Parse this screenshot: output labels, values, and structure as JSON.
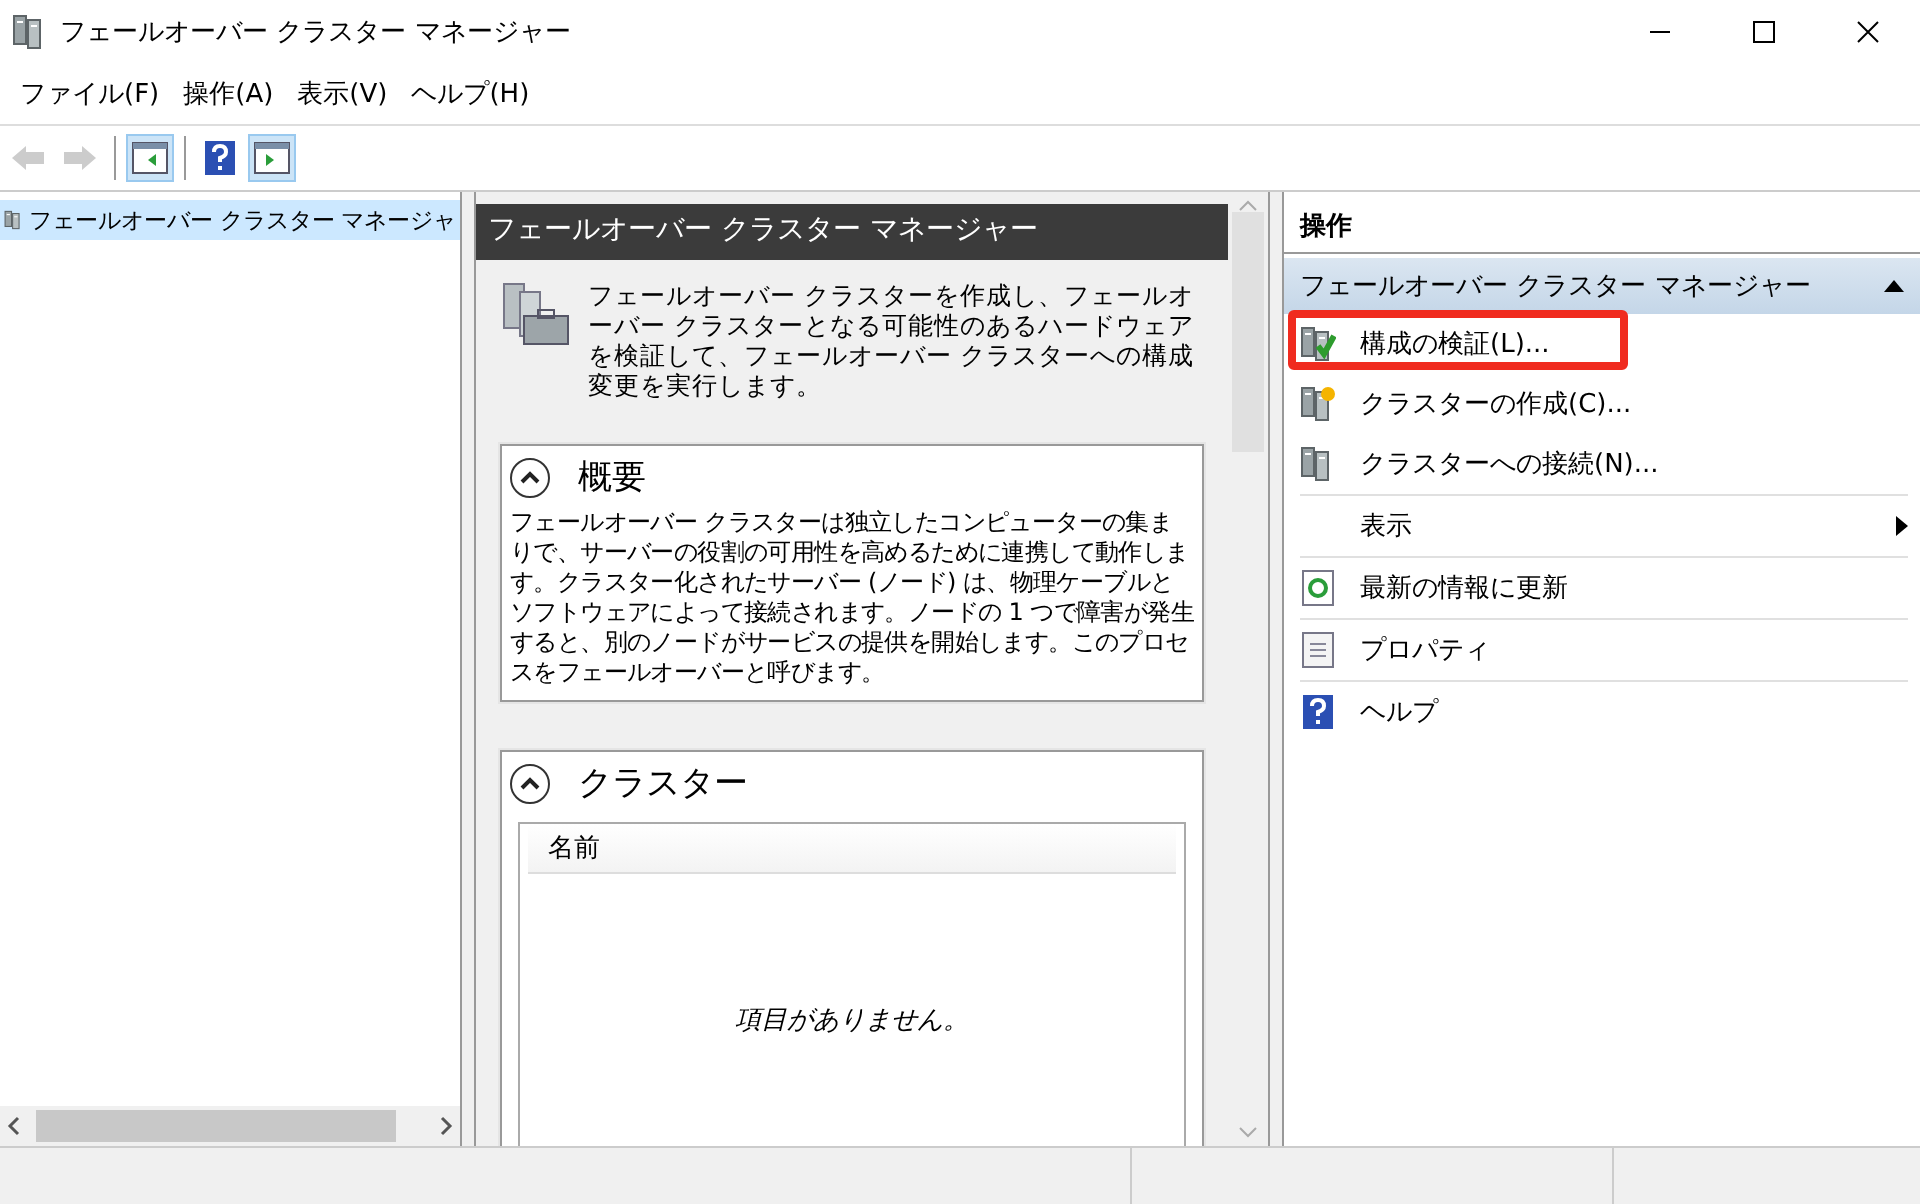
{
  "window": {
    "title": "フェールオーバー クラスター マネージャー"
  },
  "menu": [
    "ファイル(F)",
    "操作(A)",
    "表示(V)",
    "ヘルプ(H)"
  ],
  "toolbar": [
    {
      "kind": "back",
      "disabled": true,
      "pressed": false
    },
    {
      "kind": "forward",
      "disabled": true,
      "pressed": false
    },
    {
      "kind": "tree-toggle",
      "disabled": false,
      "pressed": true
    },
    {
      "kind": "help",
      "disabled": false,
      "pressed": false
    },
    {
      "kind": "action-toggle",
      "disabled": false,
      "pressed": true
    }
  ],
  "tree": {
    "items": [
      {
        "label": "フェールオーバー クラスター マネージャ",
        "selected": true
      }
    ]
  },
  "center": {
    "title": "フェールオーバー クラスター マネージャー",
    "intro": "フェールオーバー クラスターを作成し、フェールオーバー クラスターとなる可能性のあるハードウェアを検証して、フェールオーバー クラスターへの構成変更を実行します。",
    "sections": [
      {
        "kind": "text",
        "title": "概要",
        "expanded": true,
        "body": "フェールオーバー クラスターは独立したコンピューターの集まりで、サーバーの役割の可用性を高めるために連携して動作します。クラスター化されたサーバー (ノード) は、物理ケーブルとソフトウェアによって接続されます。ノードの 1 つで障害が発生すると、別のノードがサービスの提供を開始します。このプロセスをフェールオーバーと呼びます。"
      },
      {
        "kind": "list",
        "title": "クラスター",
        "expanded": true,
        "columns": [
          "名前"
        ],
        "empty_message": "項目がありません。"
      }
    ]
  },
  "actions": {
    "title": "操作",
    "group": {
      "label": "フェールオーバー クラスター マネージャー",
      "expanded": true
    },
    "items": [
      {
        "kind": "validate",
        "label": "構成の検証(L)...",
        "highlighted": true
      },
      {
        "kind": "create",
        "label": "クラスターの作成(C)...",
        "highlighted": false
      },
      {
        "kind": "connect",
        "label": "クラスターへの接続(N)...",
        "highlighted": false
      },
      {
        "kind": "submenu",
        "label": "表示",
        "highlighted": false
      },
      {
        "kind": "refresh",
        "label": "最新の情報に更新",
        "highlighted": false
      },
      {
        "kind": "properties",
        "label": "プロパティ",
        "highlighted": false
      },
      {
        "kind": "help",
        "label": "ヘルプ",
        "highlighted": false
      }
    ]
  }
}
